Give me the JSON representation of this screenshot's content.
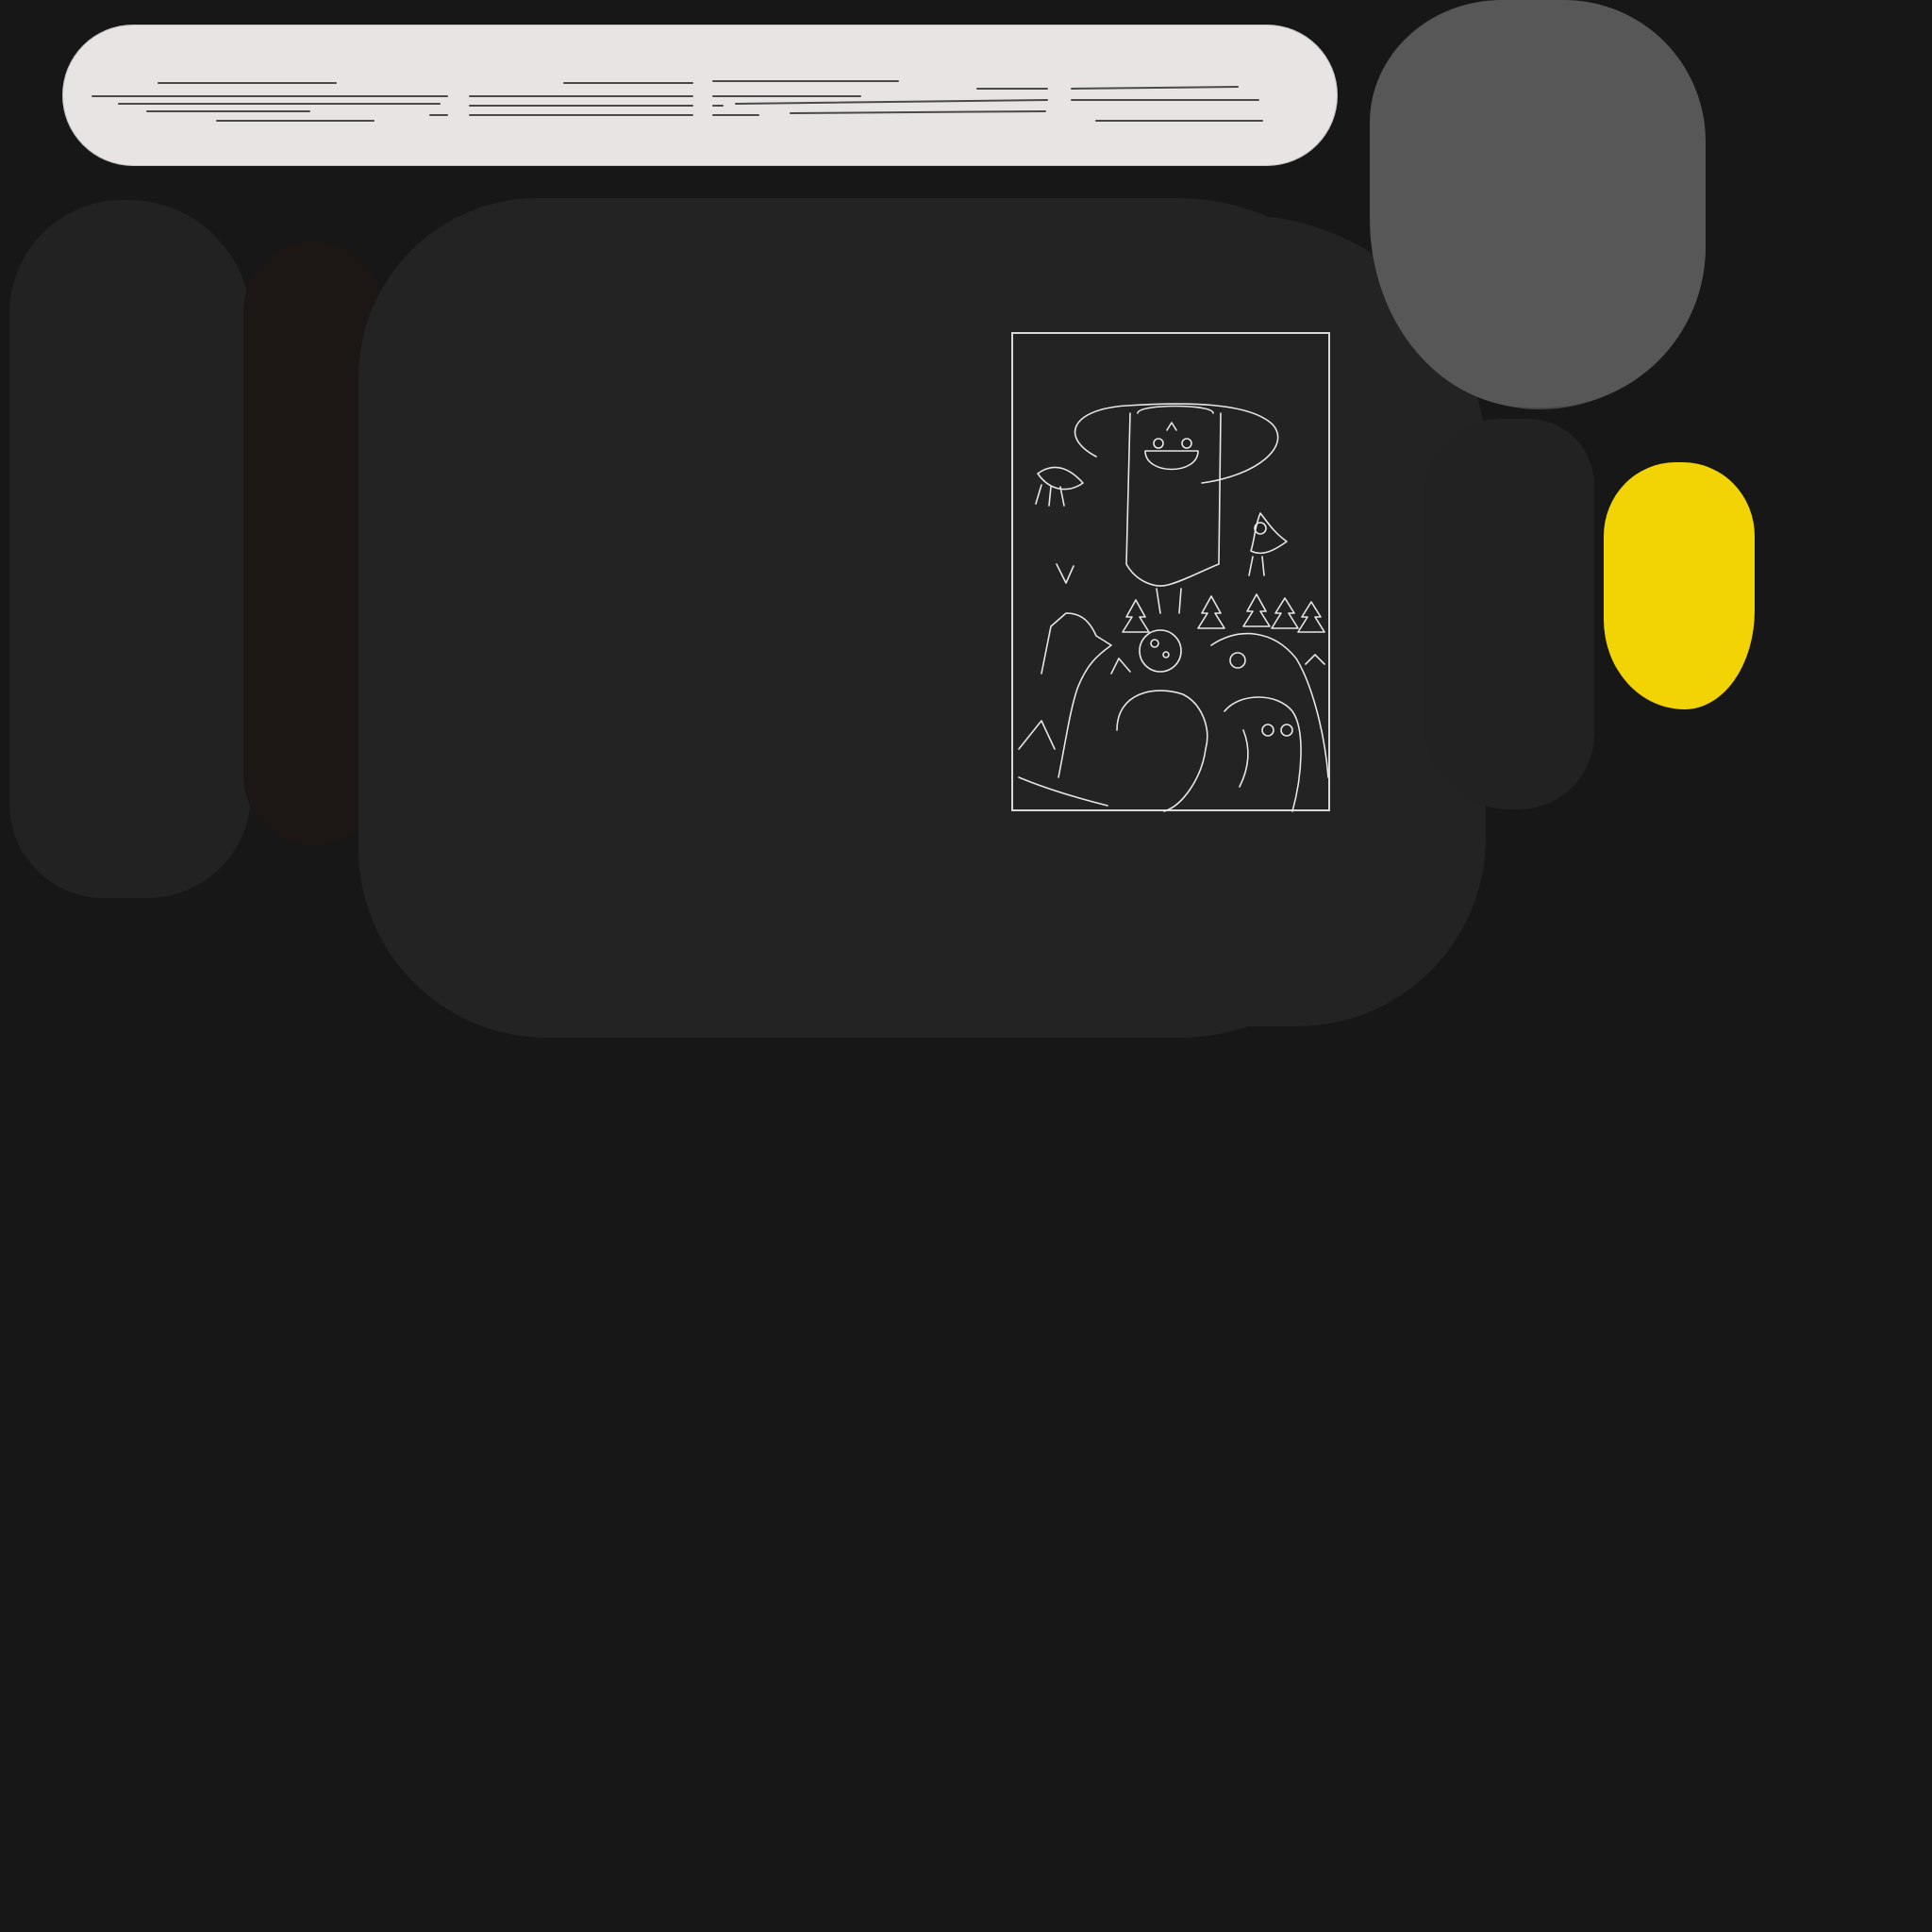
{
  "colors": {
    "background": "#171717",
    "top_bar": "#e7e4e3",
    "top_bar_lines": "#4a4a4a",
    "left_blob": "#222222",
    "mid_strip": "#1c1714",
    "main_blob": "#232323",
    "right_grey": "#575757",
    "right_grey_shadow": "#474747",
    "right_panel": "#222222",
    "yellow_blob": "#f2d303",
    "illustration_line": "#e6e6e6"
  },
  "illustration": {
    "description_icon": "character-with-hat-and-animals-line-art"
  }
}
